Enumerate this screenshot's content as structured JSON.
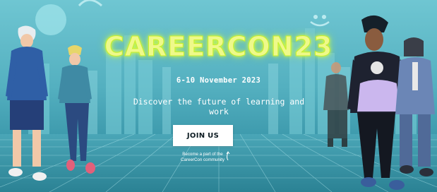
{
  "banner": {
    "title": "CAREERCON23",
    "dates": "6-10 November 2023",
    "tagline": "Discover the future of learning and work",
    "cta_label": "JOIN US",
    "cta_note_line1": "Become a part of the",
    "cta_note_line2": "CareerCon community",
    "accent_color": "#c8ef2a",
    "background_color": "#54b0c0",
    "icons": [
      "smiley-face-icon",
      "curved-arrow-up-icon"
    ]
  }
}
